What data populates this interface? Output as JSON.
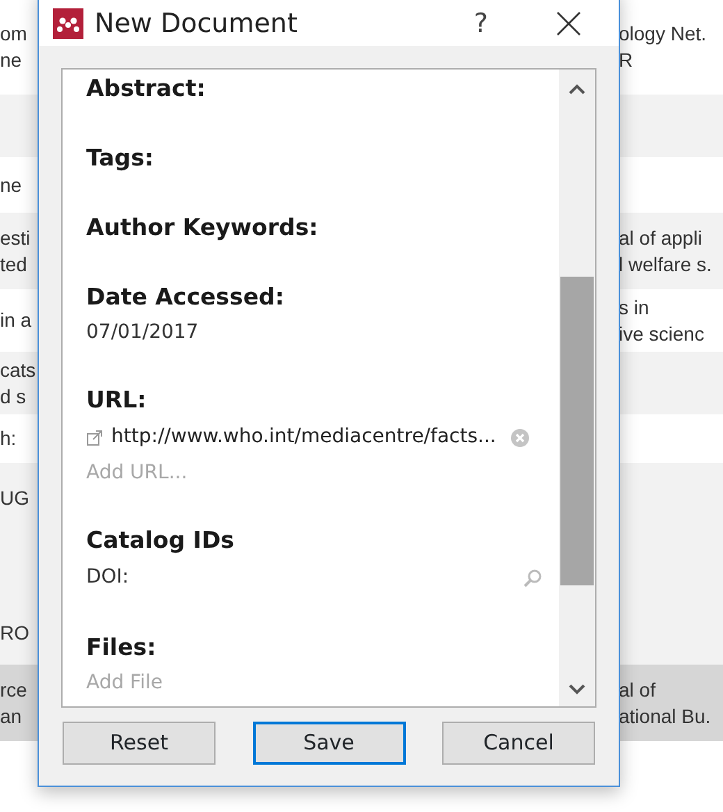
{
  "background_rows": [
    {
      "left": [
        "om",
        "ne"
      ],
      "right": [
        "ology Net.",
        "R"
      ],
      "selected": false
    },
    {
      "left": [],
      "right": [],
      "selected": false
    },
    {
      "left": [
        "ne"
      ],
      "right": [],
      "selected": false
    },
    {
      "left": [
        "esti",
        "ted"
      ],
      "right": [
        "al of appli",
        "l welfare s."
      ],
      "selected": false
    },
    {
      "left": [
        "in a"
      ],
      "right": [
        "s in",
        "ive scienc"
      ],
      "selected": false
    },
    {
      "left": [
        "cats",
        "d s"
      ],
      "right": [],
      "selected": false
    },
    {
      "left": [
        "h:"
      ],
      "right": [],
      "selected": false
    },
    {
      "left": [
        "UG"
      ],
      "right": [],
      "selected": false
    },
    {
      "left": [],
      "right": [],
      "selected": false
    },
    {
      "left": [
        "RO"
      ],
      "right": [],
      "selected": false
    },
    {
      "left": [
        "rce",
        "an"
      ],
      "right": [
        "al of",
        "ational Bu."
      ],
      "selected": true
    }
  ],
  "window": {
    "title": "New Document",
    "help": "?"
  },
  "fields": [
    {
      "kind": "heading",
      "label": "Abstract:"
    },
    {
      "kind": "heading",
      "label": "Tags:"
    },
    {
      "kind": "heading",
      "label": "Author Keywords:"
    },
    {
      "kind": "value",
      "label": "Date Accessed:",
      "value": "07/01/2017"
    },
    {
      "kind": "url",
      "label": "URL:",
      "url": "http://www.who.int/mediacentre/facts...",
      "add": "Add URL..."
    },
    {
      "kind": "catalog",
      "label": "Catalog IDs",
      "ids": [
        "DOI:"
      ]
    },
    {
      "kind": "files",
      "label": "Files:",
      "add": "Add File"
    }
  ],
  "buttons": [
    {
      "label": "Reset",
      "default": false
    },
    {
      "label": "Save",
      "default": true
    },
    {
      "label": "Cancel",
      "default": false
    }
  ]
}
